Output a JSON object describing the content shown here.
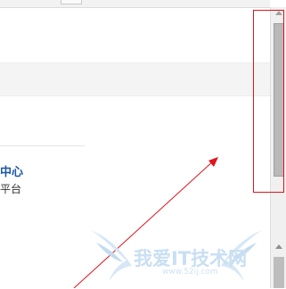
{
  "page": {
    "link_text": "中心",
    "sub_text": "平台"
  },
  "watermark": {
    "text": "我爱IT技术网",
    "url": "www.52ij.com",
    "color": "#c9dff2"
  },
  "annotation": {
    "color": "#e0141c"
  },
  "icons": [
    "scroll-up-arrow-icon",
    "watermark-wings-icon"
  ]
}
